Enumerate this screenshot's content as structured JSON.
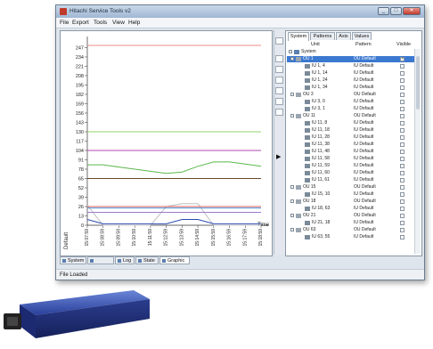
{
  "window": {
    "title": "Hitachi Service Tools v2"
  },
  "menu": [
    "File",
    "Export",
    "Tools",
    "View",
    "Help"
  ],
  "right_tabs": [
    "System",
    "Patterns",
    "Axis",
    "Values"
  ],
  "columns": {
    "unit": "Unit",
    "pattern": "Pattern",
    "visible": "Visible"
  },
  "tree": [
    {
      "label": "System",
      "level": 0,
      "type": "root",
      "pattern": "",
      "checked": false
    },
    {
      "label": "OU 1",
      "level": 1,
      "type": "ou",
      "pattern": "OU Default",
      "checked": true,
      "selected": true
    },
    {
      "label": "IU 1, 4",
      "level": 2,
      "type": "iu",
      "pattern": "IU Default",
      "checked": false
    },
    {
      "label": "IU 1, 14",
      "level": 2,
      "type": "iu",
      "pattern": "IU Default",
      "checked": false
    },
    {
      "label": "IU 1, 24",
      "level": 2,
      "type": "iu",
      "pattern": "IU Default",
      "checked": false
    },
    {
      "label": "IU 1, 34",
      "level": 2,
      "type": "iu",
      "pattern": "IU Default",
      "checked": false
    },
    {
      "label": "OU 3",
      "level": 1,
      "type": "ou",
      "pattern": "OU Default",
      "checked": false
    },
    {
      "label": "IU 3, 0",
      "level": 2,
      "type": "iu",
      "pattern": "IU Default",
      "checked": false
    },
    {
      "label": "IU 3, 1",
      "level": 2,
      "type": "iu",
      "pattern": "IU Default",
      "checked": false
    },
    {
      "label": "OU 11",
      "level": 1,
      "type": "ou",
      "pattern": "OU Default",
      "checked": false
    },
    {
      "label": "IU 11, 8",
      "level": 2,
      "type": "iu",
      "pattern": "IU Default",
      "checked": false
    },
    {
      "label": "IU 11, 18",
      "level": 2,
      "type": "iu",
      "pattern": "IU Default",
      "checked": false
    },
    {
      "label": "IU 11, 28",
      "level": 2,
      "type": "iu",
      "pattern": "IU Default",
      "checked": false
    },
    {
      "label": "IU 11, 38",
      "level": 2,
      "type": "iu",
      "pattern": "IU Default",
      "checked": false
    },
    {
      "label": "IU 11, 48",
      "level": 2,
      "type": "iu",
      "pattern": "IU Default",
      "checked": false
    },
    {
      "label": "IU 11, 58",
      "level": 2,
      "type": "iu",
      "pattern": "IU Default",
      "checked": false
    },
    {
      "label": "IU 11, 59",
      "level": 2,
      "type": "iu",
      "pattern": "IU Default",
      "checked": false
    },
    {
      "label": "IU 11, 60",
      "level": 2,
      "type": "iu",
      "pattern": "IU Default",
      "checked": false
    },
    {
      "label": "IU 11, 61",
      "level": 2,
      "type": "iu",
      "pattern": "IU Default",
      "checked": false
    },
    {
      "label": "OU 15",
      "level": 1,
      "type": "ou",
      "pattern": "OU Default",
      "checked": false
    },
    {
      "label": "IU 15, 10",
      "level": 2,
      "type": "iu",
      "pattern": "IU Default",
      "checked": false
    },
    {
      "label": "OU 18",
      "level": 1,
      "type": "ou",
      "pattern": "OU Default",
      "checked": false
    },
    {
      "label": "IU 18, 63",
      "level": 2,
      "type": "iu",
      "pattern": "IU Default",
      "checked": false
    },
    {
      "label": "OU 21",
      "level": 1,
      "type": "ou",
      "pattern": "OU Default",
      "checked": false
    },
    {
      "label": "IU 21, 18",
      "level": 2,
      "type": "iu",
      "pattern": "IU Default",
      "checked": false
    },
    {
      "label": "OU 63",
      "level": 1,
      "type": "ou",
      "pattern": "OU Default",
      "checked": false
    },
    {
      "label": "IU 63, 55",
      "level": 2,
      "type": "iu",
      "pattern": "IU Default",
      "checked": false
    }
  ],
  "bottom_tabs": [
    {
      "label": "System",
      "active": false
    },
    {
      "label": "",
      "active": false
    },
    {
      "label": "Log",
      "active": false
    },
    {
      "label": "State",
      "active": false
    },
    {
      "label": "Graphic",
      "active": true
    }
  ],
  "status": "File Loaded",
  "chart_data": {
    "type": "line",
    "ylabel": "Default",
    "xlabel": "Time",
    "yticks": [
      0,
      13,
      26,
      39,
      52,
      65,
      78,
      91,
      104,
      117,
      130,
      143,
      156,
      169,
      182,
      195,
      208,
      221,
      234,
      247
    ],
    "ylim": [
      0,
      255
    ],
    "x_ticks": [
      "15:07:59",
      "15:08:59",
      "15:09:59",
      "15:10:59",
      "15:11:59",
      "15:12:59",
      "15:13:59",
      "15:14:59",
      "15:15:59",
      "15:16:59",
      "15:17:59",
      "15:18:59"
    ],
    "series": [
      {
        "color": "#e88b8b",
        "x": [
          0,
          11
        ],
        "y": [
          250,
          250
        ]
      },
      {
        "color": "#8fd46a",
        "x": [
          0,
          11
        ],
        "y": [
          130,
          130
        ]
      },
      {
        "color": "#b04ab0",
        "x": [
          0,
          11
        ],
        "y": [
          104,
          104
        ]
      },
      {
        "color": "#5ab84a",
        "x": [
          0,
          1,
          2,
          3,
          4,
          5,
          6,
          7,
          8,
          9,
          10,
          11
        ],
        "y": [
          84,
          84,
          81,
          78,
          75,
          72,
          74,
          82,
          88,
          88,
          85,
          82
        ]
      },
      {
        "color": "#6a4a2a",
        "x": [
          0,
          11
        ],
        "y": [
          65,
          65
        ]
      },
      {
        "color": "#c0c0c0",
        "x": [
          0,
          1,
          4,
          5,
          6,
          7,
          8,
          9,
          10,
          11
        ],
        "y": [
          28,
          0,
          0,
          26,
          30,
          30,
          0,
          0,
          0,
          0
        ]
      },
      {
        "color": "#e06060",
        "x": [
          0,
          11
        ],
        "y": [
          26,
          26
        ]
      },
      {
        "color": "#4a90d0",
        "x": [
          0,
          11
        ],
        "y": [
          24,
          24
        ]
      },
      {
        "color": "#2a4ab0",
        "x": [
          0,
          1,
          5,
          6,
          7,
          8,
          11
        ],
        "y": [
          8,
          2,
          2,
          8,
          8,
          2,
          2
        ]
      },
      {
        "color": "#9a7ad0",
        "x": [
          0,
          11
        ],
        "y": [
          18,
          18
        ]
      }
    ]
  }
}
